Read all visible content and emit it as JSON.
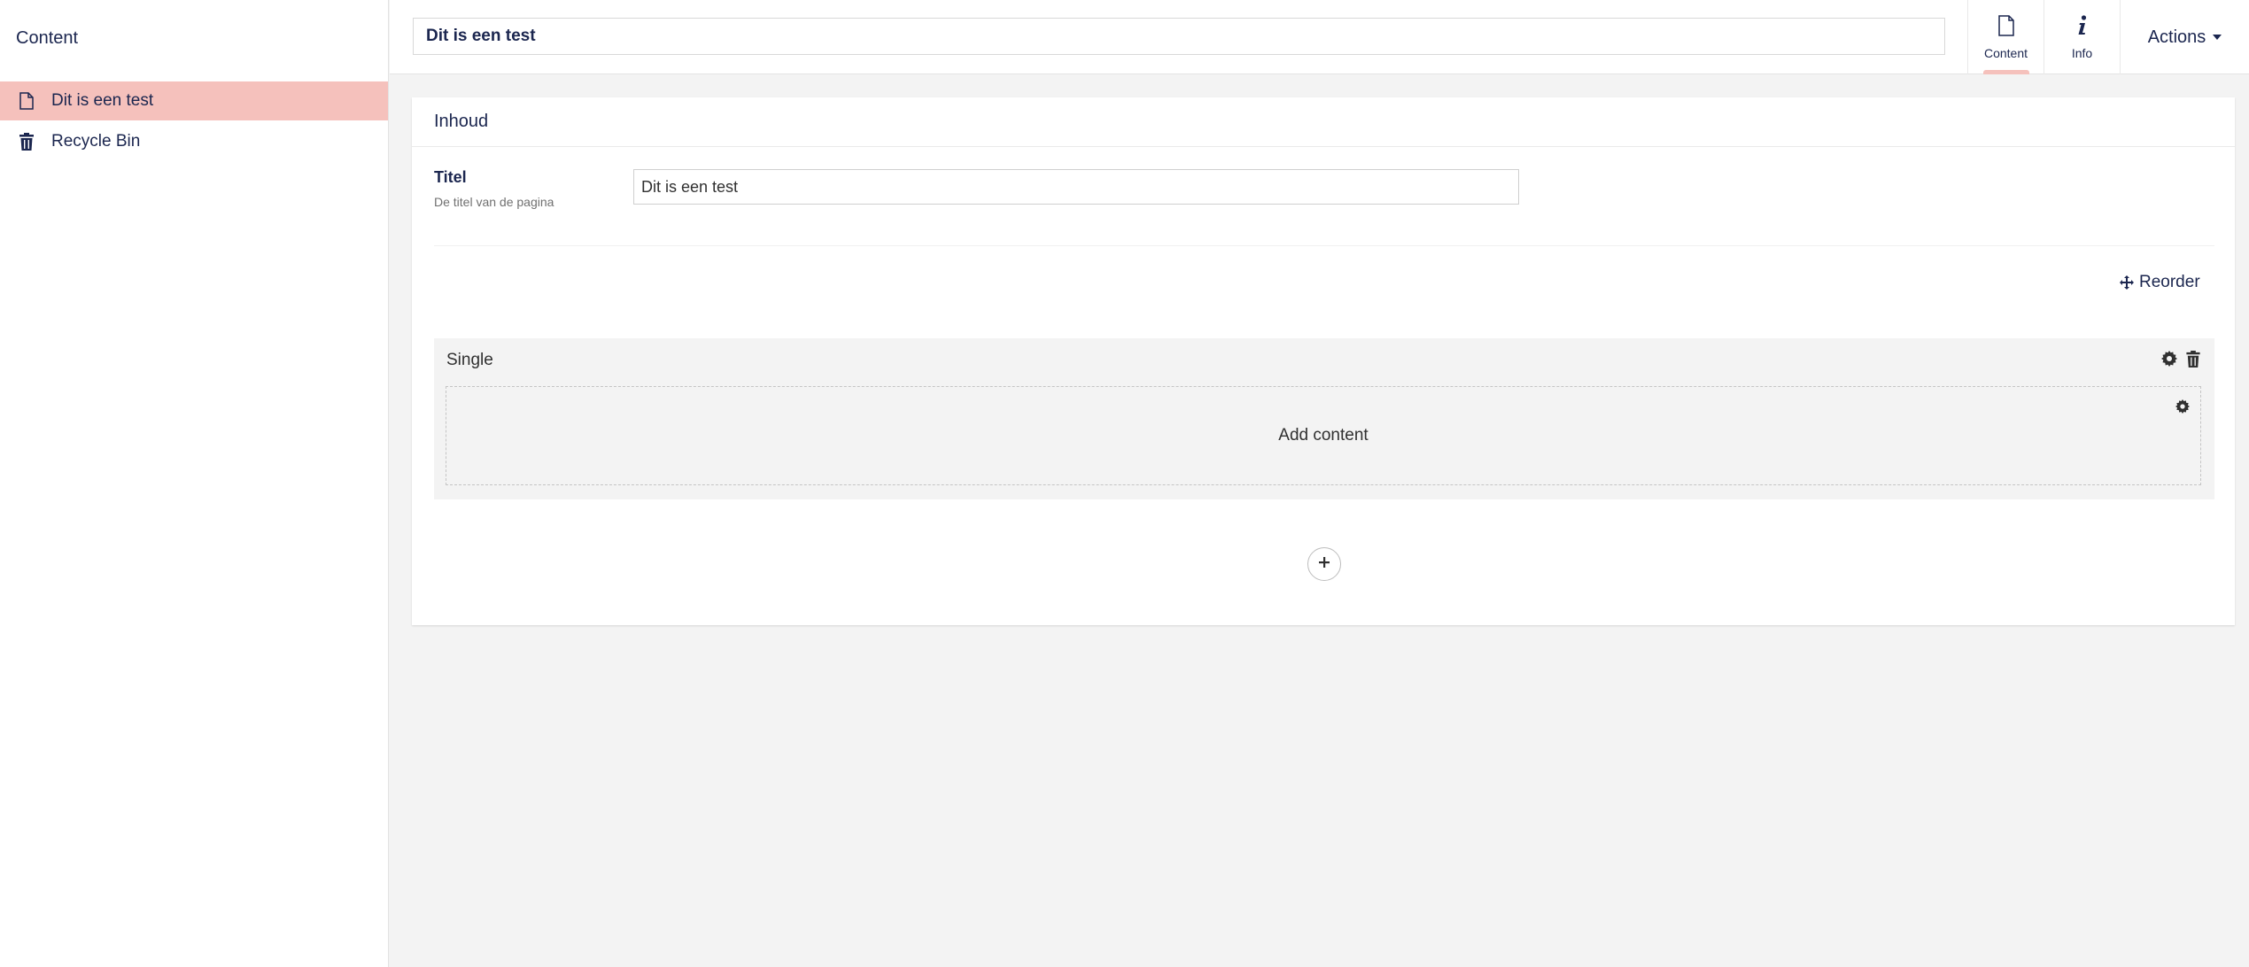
{
  "sidebar": {
    "header": "Content",
    "items": [
      {
        "label": "Dit is een test",
        "icon": "document-icon",
        "active": true
      },
      {
        "label": "Recycle Bin",
        "icon": "trash-icon",
        "active": false
      }
    ]
  },
  "header": {
    "name_value": "Dit is een test",
    "tabs": [
      {
        "label": "Content",
        "icon": "document-icon",
        "active": true
      },
      {
        "label": "Info",
        "icon": "info-icon",
        "active": false
      }
    ],
    "actions_label": "Actions"
  },
  "panel": {
    "title": "Inhoud",
    "property": {
      "label": "Titel",
      "description": "De titel van de pagina",
      "value": "Dit is een test"
    },
    "reorder_label": "Reorder",
    "grid_row": {
      "name": "Single",
      "add_content_label": "Add content"
    }
  },
  "colors": {
    "accent": "#f5c1bc",
    "text": "#1b264f",
    "background": "#f3f3f3"
  }
}
